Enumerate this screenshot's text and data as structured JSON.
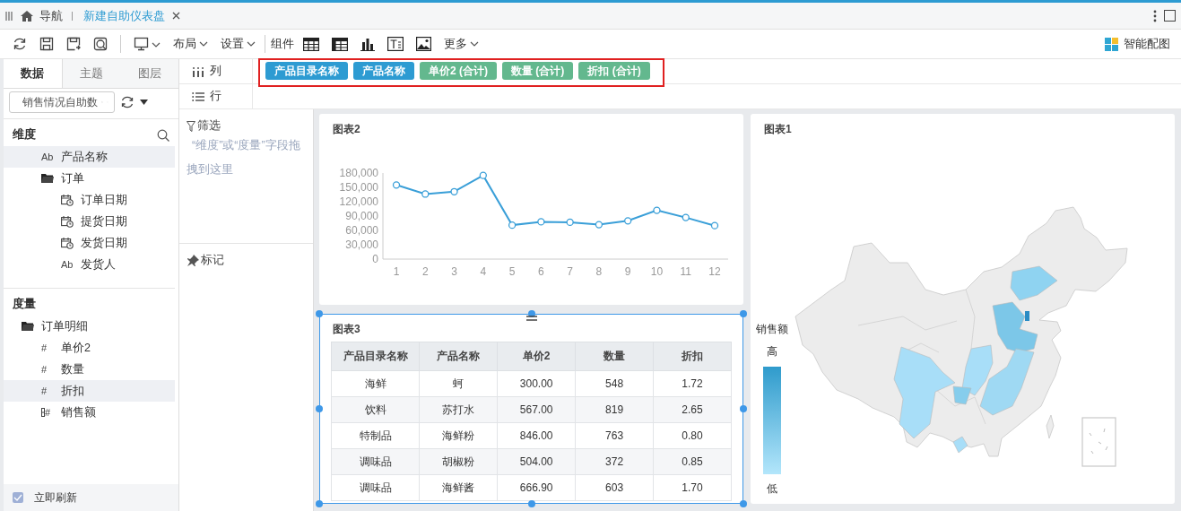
{
  "tabbar": {
    "nav_label": "导航",
    "tabs": [
      {
        "label": "新建自助仪表盘",
        "selected": true
      }
    ]
  },
  "toolbar": {
    "menus": [
      "布局",
      "设置"
    ],
    "components_label": "组件",
    "more": "更多",
    "smart_chart": "智能配图"
  },
  "data_panel": {
    "tabs": [
      {
        "label": "数据",
        "selected": true
      },
      {
        "label": "主题",
        "selected": false
      },
      {
        "label": "图层",
        "selected": false
      }
    ],
    "dataset": {
      "value": "销售情况自助数"
    },
    "dimensions": {
      "title": "维度",
      "items": [
        {
          "label": "产品名称",
          "kind": "text",
          "glyph": "Ab",
          "selected": true
        },
        {
          "label": "订单",
          "kind": "folder",
          "selected": false,
          "children": [
            {
              "label": "订单日期",
              "kind": "date",
              "selected": false
            },
            {
              "label": "提货日期",
              "kind": "date",
              "selected": false
            },
            {
              "label": "发货日期",
              "kind": "date",
              "selected": false
            },
            {
              "label": "发货人",
              "kind": "text",
              "glyph": "Ab",
              "selected": false
            }
          ]
        }
      ]
    },
    "measures": {
      "title": "度量",
      "items": [
        {
          "label": "订单明细",
          "kind": "folder",
          "selected": false,
          "children": [
            {
              "label": "单价2",
              "kind": "number",
              "glyph": "#",
              "selected": false
            },
            {
              "label": "数量",
              "kind": "number",
              "glyph": "#",
              "selected": false
            },
            {
              "label": "折扣",
              "kind": "number",
              "glyph": "#",
              "selected": true
            },
            {
              "label": "销售额",
              "kind": "calc",
              "glyph": "#",
              "selected": false
            }
          ]
        }
      ]
    },
    "auto_refresh": {
      "label": "立即刷新",
      "checked": true
    }
  },
  "shelf": {
    "columns": {
      "label": "列",
      "fields": [
        {
          "label": "产品目录名称",
          "kind": "dimension"
        },
        {
          "label": "产品名称",
          "kind": "dimension"
        },
        {
          "label": "单价2 (合计)",
          "kind": "measure"
        },
        {
          "label": "数量 (合计)",
          "kind": "measure"
        },
        {
          "label": "折扣 (合计)",
          "kind": "measure"
        }
      ]
    },
    "rows": {
      "label": "行"
    }
  },
  "filter": {
    "title": "筛选",
    "hint": "“维度”或“度量”字段拖拽到这里"
  },
  "marks": {
    "title": "标记"
  },
  "line_chart": {
    "chart_data": {
      "type": "line",
      "title": "图表2",
      "categories": [
        "1",
        "2",
        "3",
        "4",
        "5",
        "6",
        "7",
        "8",
        "9",
        "10",
        "11",
        "12"
      ],
      "series": [
        {
          "color": "#3a9fd8",
          "marker": "circle",
          "values": [
            155000,
            136000,
            141000,
            175000,
            71000,
            78000,
            77000,
            72000,
            80000,
            102000,
            87000,
            70000
          ]
        }
      ],
      "ylim": [
        0,
        180000
      ],
      "yticks": [
        {
          "value": 0,
          "label": "0"
        },
        {
          "value": 30000,
          "label": "30,000"
        },
        {
          "value": 60000,
          "label": "60,000"
        },
        {
          "value": 90000,
          "label": "90,000"
        },
        {
          "value": 120000,
          "label": "120,000"
        },
        {
          "value": 150000,
          "label": "150,000"
        },
        {
          "value": 180000,
          "label": "180,000"
        }
      ]
    }
  },
  "table_chart": {
    "title": "图表3",
    "selected": true,
    "columns": [
      "产品目录名称",
      "产品名称",
      "单价2",
      "数量",
      "折扣"
    ],
    "rows": [
      [
        "海鲜",
        "蚵",
        "300.00",
        "548",
        "1.72"
      ],
      [
        "饮料",
        "苏打水",
        "567.00",
        "819",
        "2.65"
      ],
      [
        "特制品",
        "海鲜粉",
        "846.00",
        "763",
        "0.80"
      ],
      [
        "调味品",
        "胡椒粉",
        "504.00",
        "372",
        "0.85"
      ],
      [
        "调味品",
        "海鲜酱",
        "666.90",
        "603",
        "1.70"
      ]
    ]
  },
  "map_chart": {
    "title": "图表1",
    "legend": {
      "title": "销售额",
      "high": "高",
      "low": "低"
    }
  }
}
